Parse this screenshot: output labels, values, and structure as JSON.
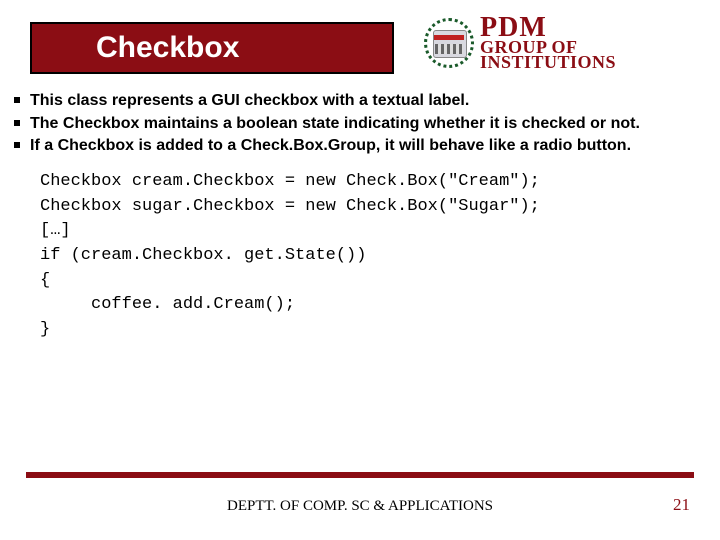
{
  "title": "Checkbox",
  "logo": {
    "line1": "PDM",
    "line2": "GROUP OF",
    "line3": "INSTITUTIONS"
  },
  "bullets": [
    "This class represents a GUI checkbox with a textual label.",
    "The Checkbox maintains a boolean state indicating whether it is checked or not.",
    "If a Checkbox is added to a Check.Box.Group, it will behave like a radio button."
  ],
  "code_lines": [
    "Checkbox cream.Checkbox = new Check.Box(\"Cream\");",
    "Checkbox sugar.Checkbox = new Check.Box(\"Sugar\");",
    "[…]",
    "if (cream.Checkbox. get.State())",
    "{",
    "     coffee. add.Cream();",
    "}"
  ],
  "footer": {
    "dept": "DEPTT. OF COMP. SC & APPLICATIONS",
    "page": "21"
  }
}
